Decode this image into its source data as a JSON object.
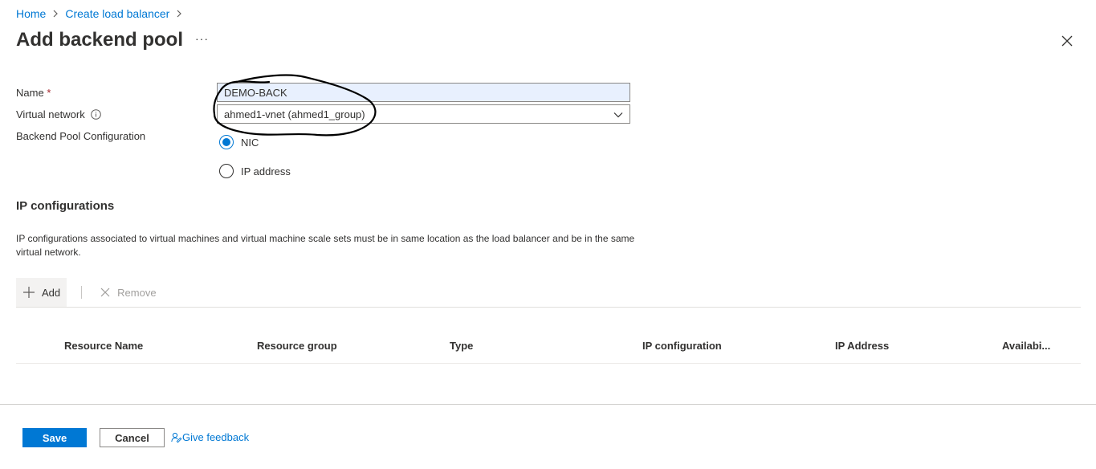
{
  "breadcrumb": [
    "Home",
    "Create load balancer"
  ],
  "page": {
    "title": "Add backend pool",
    "more": "···"
  },
  "form": {
    "name_label": "Name",
    "required_mark": "*",
    "name_value": "DEMO-BACK",
    "vnet_label": "Virtual network",
    "vnet_value": "ahmed1-vnet (ahmed1_group)",
    "config_label": "Backend Pool Configuration",
    "options": [
      {
        "label": "NIC",
        "selected": true
      },
      {
        "label": "IP address",
        "selected": false
      }
    ]
  },
  "ip_section": {
    "title": "IP configurations",
    "description": "IP configurations associated to virtual machines and virtual machine scale sets must be in same location as the load balancer and be in the same virtual network."
  },
  "toolbar": {
    "add": "Add",
    "remove": "Remove"
  },
  "table": {
    "columns": [
      "Resource Name",
      "Resource group",
      "Type",
      "IP configuration",
      "IP Address",
      "Availabi..."
    ]
  },
  "footer": {
    "save": "Save",
    "cancel": "Cancel",
    "feedback": "Give feedback"
  },
  "colors": {
    "accent": "#0078d4",
    "required": "#a4262c",
    "input_fill": "#e8f0fe"
  }
}
